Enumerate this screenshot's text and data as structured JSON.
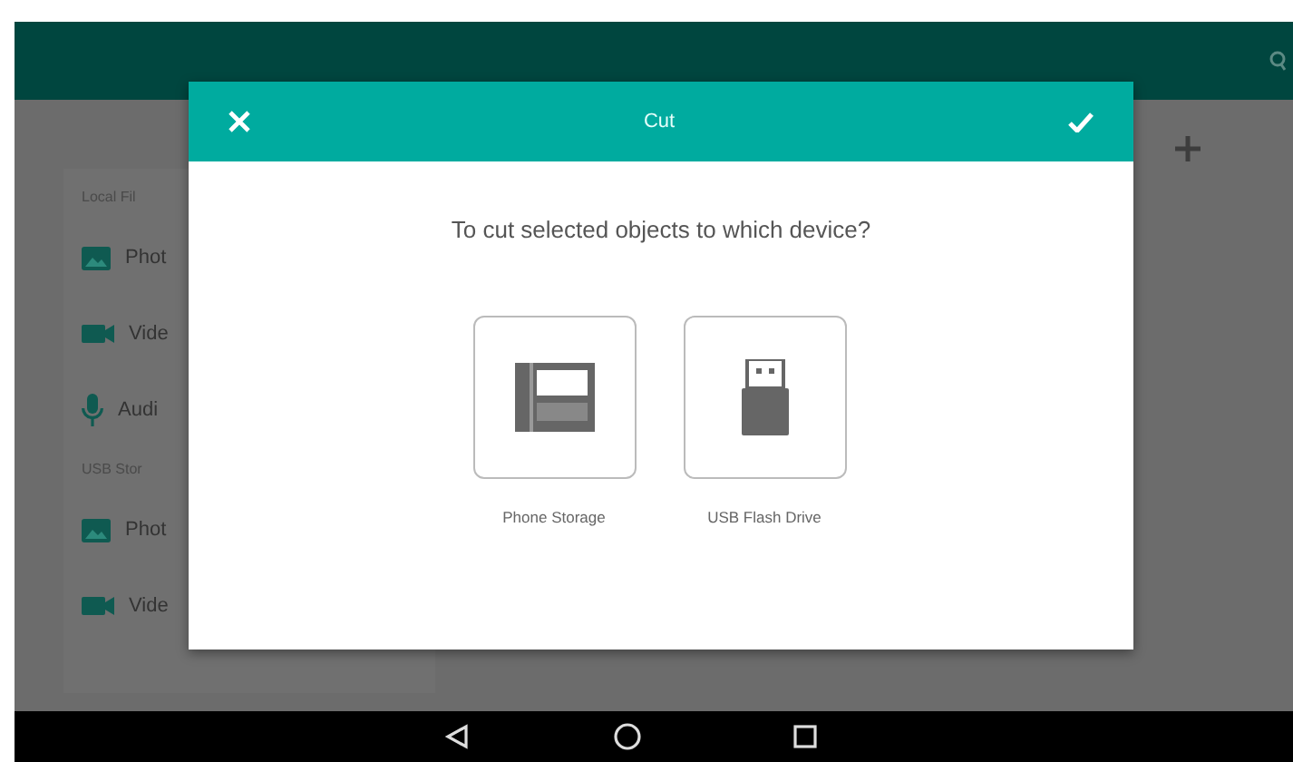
{
  "sidebar": {
    "sections": [
      {
        "label": "Local Fil",
        "items": [
          {
            "label": "Phot",
            "kind": "photo"
          },
          {
            "label": "Vide",
            "kind": "video"
          },
          {
            "label": "Audi",
            "kind": "audio"
          }
        ]
      },
      {
        "label": "USB Stor",
        "items": [
          {
            "label": "Phot",
            "kind": "photo"
          },
          {
            "label": "Vide",
            "kind": "video"
          }
        ]
      }
    ]
  },
  "dialog": {
    "title": "Cut",
    "question": "To cut selected objects to which device?",
    "options": [
      {
        "label": "Phone Storage",
        "kind": "phone"
      },
      {
        "label": "USB Flash Drive",
        "kind": "usb"
      }
    ]
  }
}
